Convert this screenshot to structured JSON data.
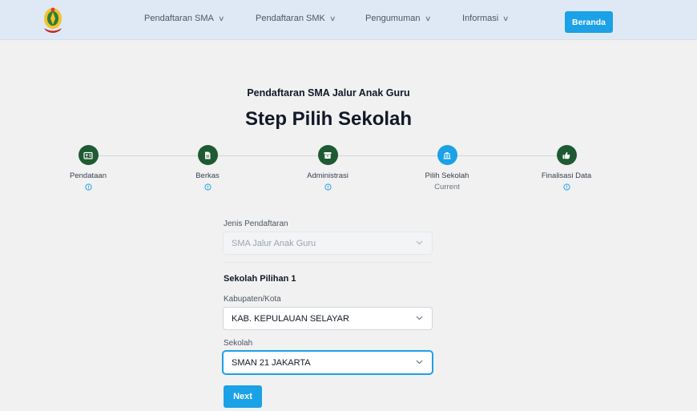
{
  "navbar": {
    "logo_icon": "provincial-emblem-icon",
    "items": [
      {
        "label": "Pendaftaran SMA"
      },
      {
        "label": "Pendaftaran SMK"
      },
      {
        "label": "Pengumuman"
      },
      {
        "label": "Informasi"
      }
    ],
    "home_button": "Beranda"
  },
  "header": {
    "subtitle": "Pendaftaran SMA Jalur Anak Guru",
    "title": "Step Pilih Sekolah"
  },
  "stepper": {
    "steps": [
      {
        "label": "Pendataan",
        "icon": "id-card-icon",
        "state": "done"
      },
      {
        "label": "Berkas",
        "icon": "document-icon",
        "state": "done"
      },
      {
        "label": "Administrasi",
        "icon": "archive-icon",
        "state": "done"
      },
      {
        "label": "Pilih Sekolah",
        "icon": "school-icon",
        "state": "current",
        "status": "Current"
      },
      {
        "label": "Finalisasi Data",
        "icon": "thumbs-up-icon",
        "state": "done"
      }
    ]
  },
  "form": {
    "jenis_label": "Jenis Pendaftaran",
    "jenis_value": "SMA Jalur Anak Guru",
    "section_title": "Sekolah Pilihan 1",
    "kabupaten_label": "Kabupaten/Kota",
    "kabupaten_value": "KAB. KEPULAUAN SELAYAR",
    "sekolah_label": "Sekolah",
    "sekolah_value": "SMAN 21 JAKARTA",
    "next_label": "Next"
  },
  "colors": {
    "accent": "#1aa1e6",
    "step_done": "#1e5a32",
    "navbar_bg": "#dfe9f6",
    "page_bg": "#f1f1f1"
  }
}
